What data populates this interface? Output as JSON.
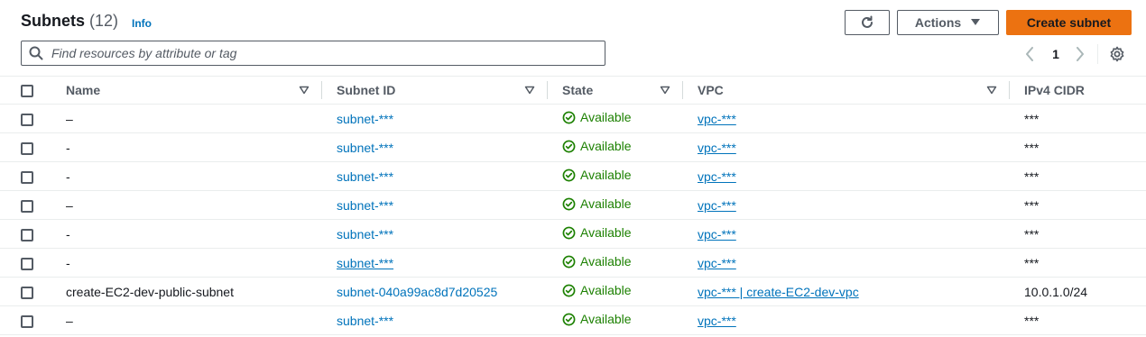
{
  "header": {
    "title": "Subnets",
    "count": "(12)",
    "info": "Info",
    "actions_label": "Actions",
    "create_label": "Create subnet"
  },
  "icons": {
    "refresh": "refresh-icon",
    "caret": "caret-down-icon",
    "search": "search-icon",
    "settings": "gear-icon",
    "available": "check-circle-icon"
  },
  "colors": {
    "primary_button": "#ec7211",
    "link": "#0073bb",
    "available": "#1d8102"
  },
  "search": {
    "placeholder": "Find resources by attribute or tag"
  },
  "pagination": {
    "current_page": "1"
  },
  "table": {
    "columns": [
      "Name",
      "Subnet ID",
      "State",
      "VPC",
      "IPv4 CIDR"
    ],
    "rows": [
      {
        "name": "–",
        "subnet_id": "subnet-***",
        "state": "Available",
        "vpc": "vpc-***",
        "cidr": "***"
      },
      {
        "name": "-",
        "subnet_id": "subnet-***",
        "state": "Available",
        "vpc": "vpc-***",
        "cidr": "***"
      },
      {
        "name": "-",
        "subnet_id": "subnet-***",
        "state": "Available",
        "vpc": "vpc-***",
        "cidr": "***"
      },
      {
        "name": "–",
        "subnet_id": "subnet-***",
        "state": "Available",
        "vpc": "vpc-***",
        "cidr": "***"
      },
      {
        "name": "-",
        "subnet_id": "subnet-***",
        "state": "Available",
        "vpc": "vpc-***",
        "cidr": "***"
      },
      {
        "name": "-",
        "subnet_id": "subnet-***",
        "state": "Available",
        "vpc": "vpc-***",
        "cidr": "***"
      },
      {
        "name": "create-EC2-dev-public-subnet",
        "subnet_id": "subnet-040a99ac8d7d20525",
        "state": "Available",
        "vpc": "vpc-*** | create-EC2-dev-vpc",
        "cidr": "10.0.1.0/24"
      },
      {
        "name": "–",
        "subnet_id": "subnet-***",
        "state": "Available",
        "vpc": "vpc-***",
        "cidr": "***"
      }
    ]
  }
}
